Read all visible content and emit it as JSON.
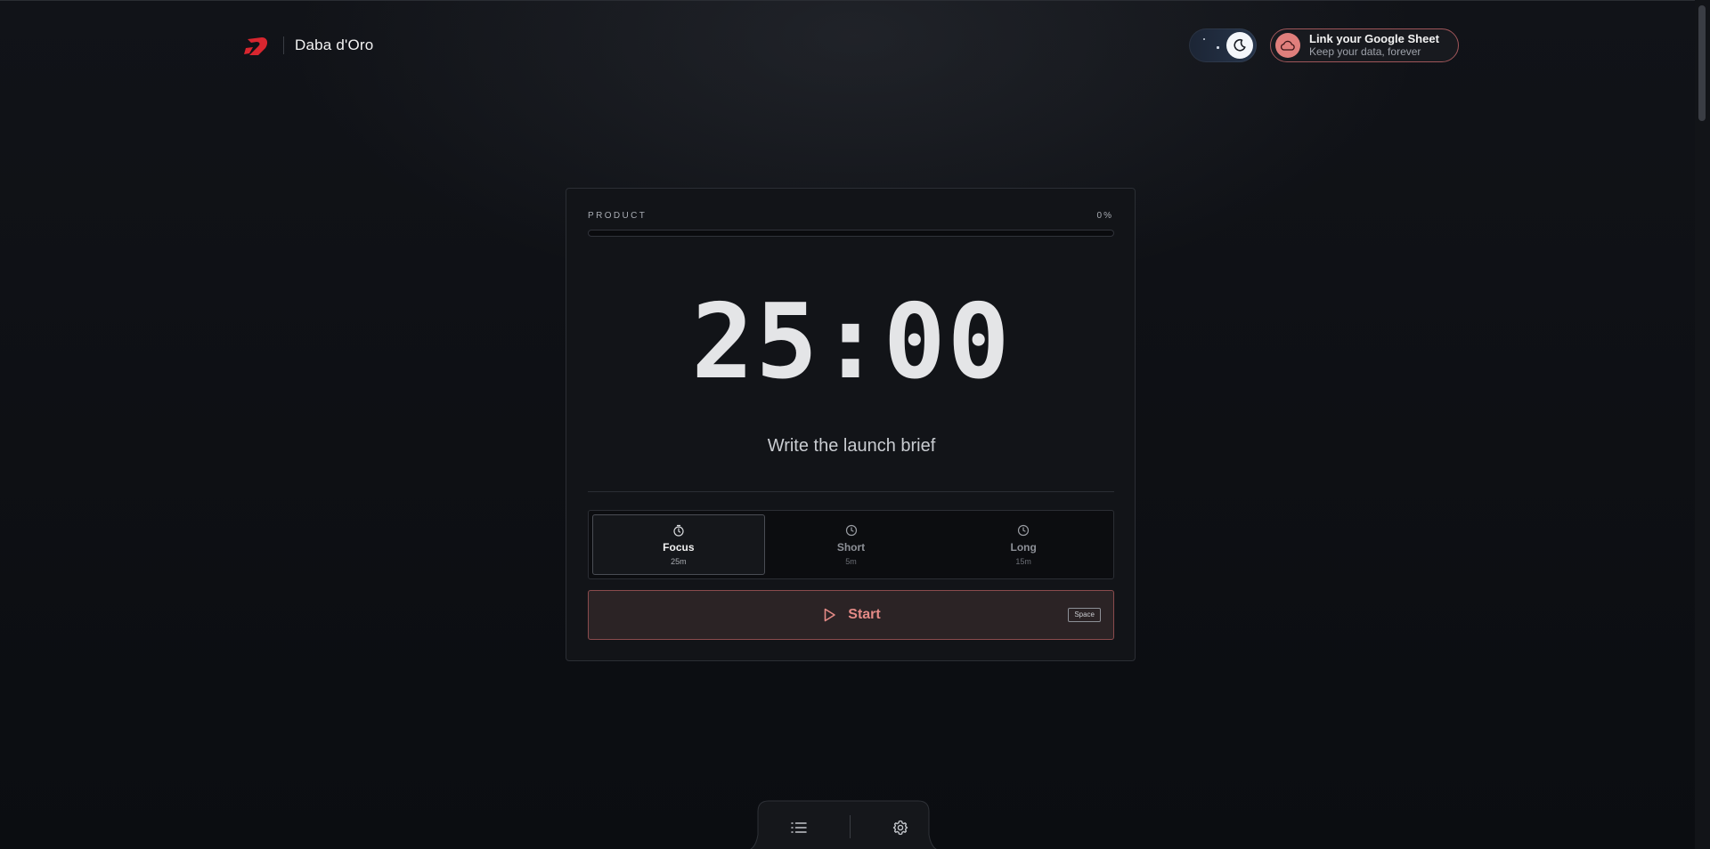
{
  "header": {
    "brand_name": "Daba d'Oro",
    "logo_icon": "brand-logo-icon",
    "theme_toggle_icon": "moon-icon",
    "gsheet": {
      "title": "Link your Google Sheet",
      "subtitle": "Keep your data, forever",
      "icon": "cloud-icon"
    }
  },
  "timer_card": {
    "project_label": "PRODUCT",
    "progress_label": "0%",
    "progress": 0,
    "time": "25:00",
    "task": "Write the launch brief",
    "modes": [
      {
        "label": "Focus",
        "duration": "25m",
        "icon": "timer-icon",
        "active": true
      },
      {
        "label": "Short",
        "duration": "5m",
        "icon": "clock-icon",
        "active": false
      },
      {
        "label": "Long",
        "duration": "15m",
        "icon": "clock-icon",
        "active": false
      }
    ],
    "start": {
      "label": "Start",
      "icon": "play-icon",
      "shortcut": "Space"
    }
  },
  "dock": {
    "items": [
      {
        "icon": "list-icon"
      },
      {
        "icon": "gear-icon"
      }
    ]
  },
  "colors": {
    "accent": "#e06a6a",
    "background": "#0c0e12",
    "card": "#121418"
  }
}
